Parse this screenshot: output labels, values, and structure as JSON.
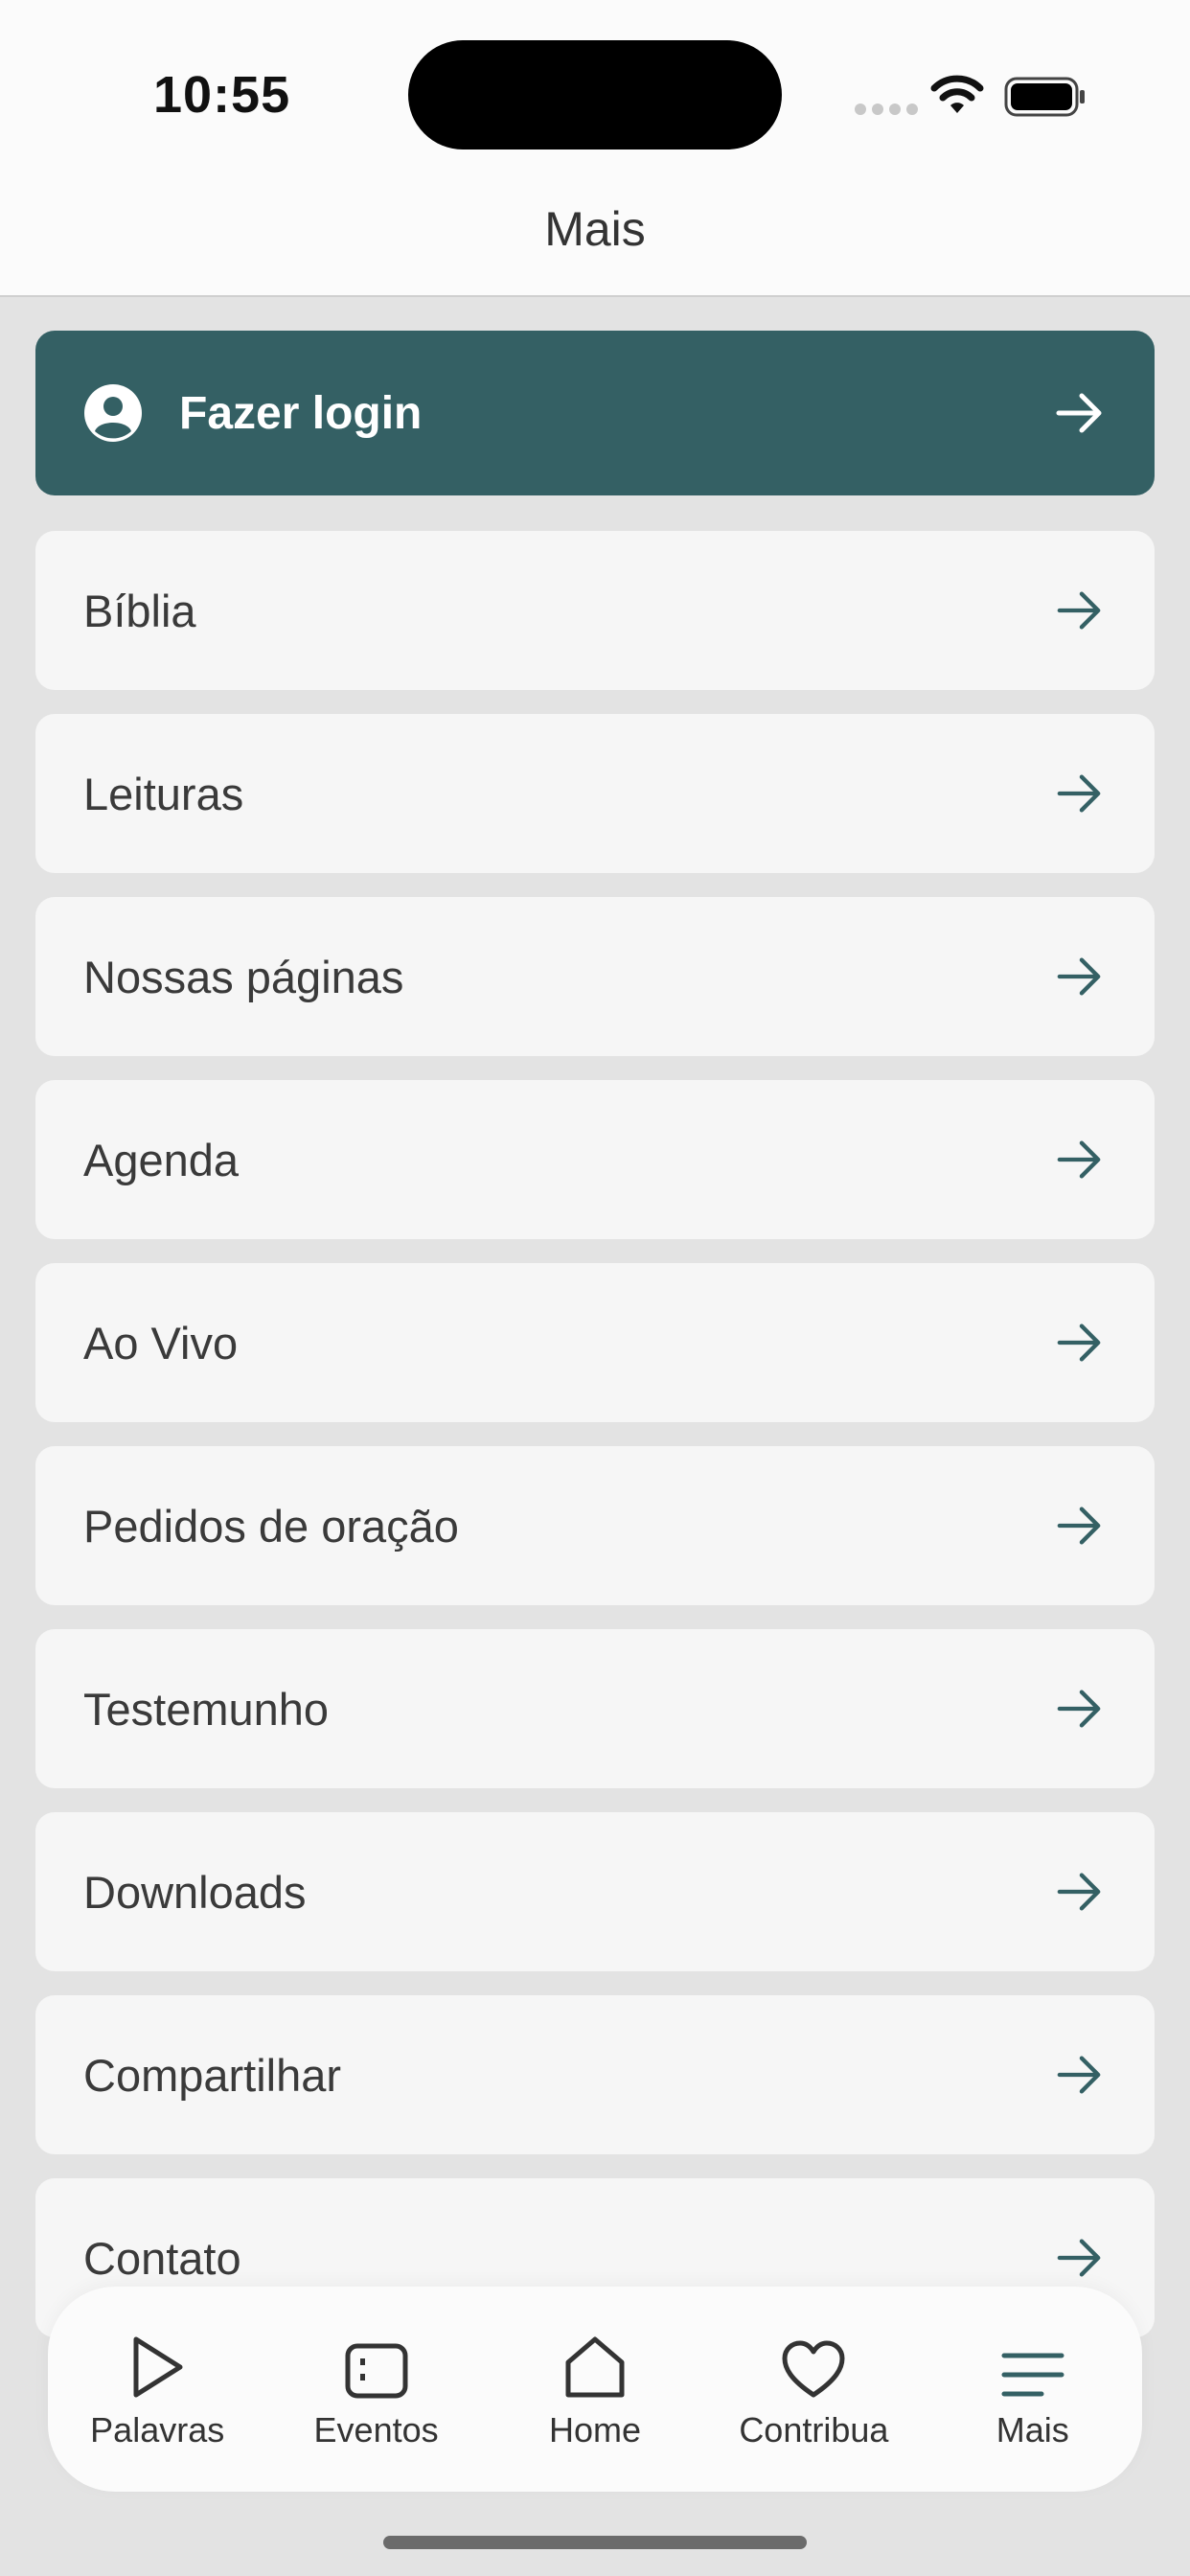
{
  "status": {
    "time": "10:55"
  },
  "header": {
    "title": "Mais"
  },
  "login": {
    "label": "Fazer login"
  },
  "menu": {
    "items": [
      {
        "label": "Bíblia"
      },
      {
        "label": "Leituras"
      },
      {
        "label": "Nossas páginas"
      },
      {
        "label": "Agenda"
      },
      {
        "label": "Ao Vivo"
      },
      {
        "label": "Pedidos de oração"
      },
      {
        "label": "Testemunho"
      },
      {
        "label": "Downloads"
      },
      {
        "label": "Compartilhar"
      },
      {
        "label": "Contato"
      }
    ]
  },
  "tabs": [
    {
      "label": "Palavras",
      "icon": "play-icon"
    },
    {
      "label": "Eventos",
      "icon": "calendar-icon"
    },
    {
      "label": "Home",
      "icon": "home-icon"
    },
    {
      "label": "Contribua",
      "icon": "heart-icon"
    },
    {
      "label": "Mais",
      "icon": "menu-icon"
    }
  ],
  "colors": {
    "accent": "#346064",
    "background": "#e3e3e3",
    "card": "#f6f6f6"
  }
}
